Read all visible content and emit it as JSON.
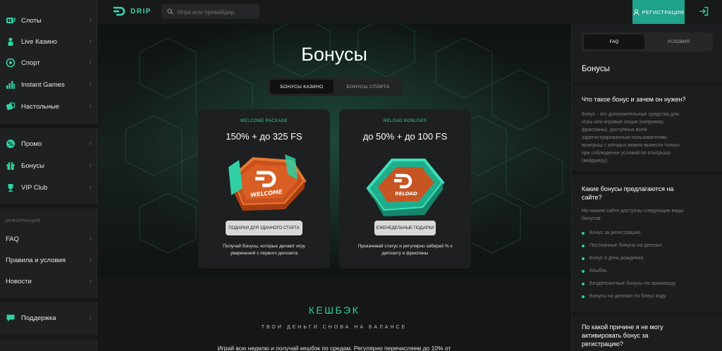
{
  "colors": {
    "accent": "#2fd1a4",
    "accent_button": "#1fa38a",
    "bg": "#151716",
    "panel": "#1e1f20"
  },
  "sidebar": {
    "items_top": [
      {
        "label": "Слоты",
        "icon": "slot-machine-icon"
      },
      {
        "label": "Live Казино",
        "icon": "live-casino-icon"
      },
      {
        "label": "Спорт",
        "icon": "soccer-ball-icon"
      },
      {
        "label": "Instant Games",
        "icon": "bar-chart-icon"
      },
      {
        "label": "Настольные",
        "icon": "dice-icon"
      }
    ],
    "items_mid": [
      {
        "label": "Промо",
        "icon": "percent-icon"
      },
      {
        "label": "Бонусы",
        "icon": "gift-icon"
      },
      {
        "label": "VIP Club",
        "icon": "trophy-icon"
      }
    ],
    "section_info": "ИНФОРМАЦИЯ",
    "items_info": [
      {
        "label": "FAQ"
      },
      {
        "label": "Правила и условия"
      },
      {
        "label": "Новости"
      }
    ],
    "support": {
      "label": "Поддержка",
      "icon": "chat-icon"
    }
  },
  "header": {
    "logo_text": "DRIP",
    "search_placeholder": "Игра или провайдер",
    "register_label": "РЕГИСТРАЦИЯ"
  },
  "main": {
    "title": "Бонусы",
    "tabs": [
      {
        "label": "БОНУСЫ КАЗИНО"
      },
      {
        "label": "БОНУСЫ СПОРТА"
      }
    ],
    "cards": [
      {
        "label": "WELCOME PACKAGE",
        "headline": "150% + до 325 FS",
        "art_text": "WELCOME",
        "cta": "ПОДАРКИ ДЛЯ УДАЧНОГО СТАРТА",
        "desc_1": "Получай бонусы, которые делают игру",
        "desc_2": "увереннной с первого депозита"
      },
      {
        "label": "RELOAD BONUSES",
        "headline": "до 50% + до 100 FS",
        "art_text": "RELOAD",
        "cta": "ЕЖЕНЕДЕЛЬНЫЕ ПОДАРКИ",
        "desc_1": "Прокачивай статус и регулярно забирай % к",
        "desc_2": "депозиту и фриспины"
      }
    ],
    "cashback": {
      "title": "КЕШБЭК",
      "subtitle": "ТВОИ ДЕНЬГИ СНОВА НА БАЛАНСЕ",
      "text": "Играй всю неделю и получай кешбэк по средам. Регулярно перечисляем до 10% от"
    }
  },
  "faq": {
    "tabs": [
      {
        "label": "FAQ"
      },
      {
        "label": "УСЛОВИЯ"
      }
    ],
    "heading": "Бонусы",
    "q1": "Что такое бонус и зачем он нужен?",
    "a1": [
      "Бонус - это дополнительные средства для",
      "игры или игровые опции (например,",
      "фриспины), доступные всем",
      "зарегистрированным пользователям,",
      "выигрыш с которых можно вывести только",
      "при соблюдении условий по отыгрышу",
      "(вейджеру)."
    ],
    "q2_1": "Какие бонусы предлагаются на",
    "q2_2": "сайте?",
    "a2_1": "На нашем сайте доступны следующие виды",
    "a2_2": "бонусов:",
    "list": [
      "Бонус за регистрацию.",
      "Постоянные бонусы на депозит.",
      "Бонус в день рождения.",
      "Кешбэк.",
      "Бездепозитные бонусы по промокоду.",
      "Бонусы на депозит по бонус коду."
    ],
    "q3_1": "По какой причине я не могу",
    "q3_2": "активировать бонус за",
    "q3_3": "регистрацию?"
  }
}
